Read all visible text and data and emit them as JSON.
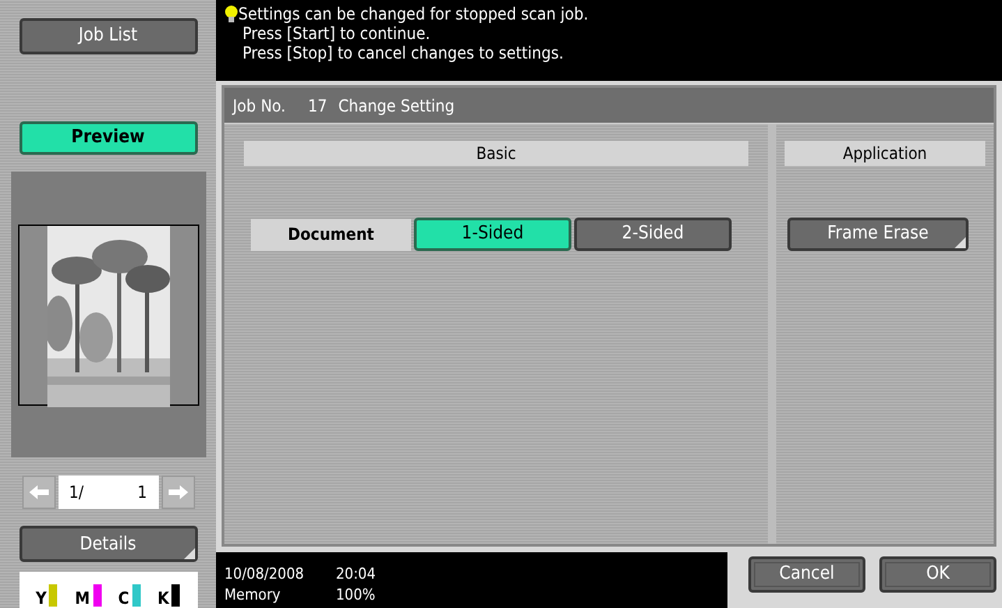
{
  "sidebar": {
    "job_list_button": "Job List",
    "preview_button": {
      "label": "Preview",
      "selected": true
    },
    "pager": {
      "page": "1/",
      "total": "1"
    },
    "details_button": "Details",
    "toners": [
      {
        "label": "Y",
        "color": "#c8c800"
      },
      {
        "label": "M",
        "color": "#f000f0"
      },
      {
        "label": "C",
        "color": "#30c8c8"
      },
      {
        "label": "K",
        "color": "#000000"
      }
    ]
  },
  "message": {
    "lines": [
      "Settings can be changed for stopped scan job.",
      "Press [Start] to continue.",
      "Press [Stop] to cancel changes to settings."
    ]
  },
  "panel": {
    "job_label": "Job No.",
    "job_number": "17",
    "title": "Change Setting",
    "basic": {
      "header": "Basic",
      "row_label": "Document",
      "options": [
        {
          "label": "1-Sided",
          "selected": true
        },
        {
          "label": "2-Sided",
          "selected": false
        }
      ]
    },
    "application": {
      "header": "Application",
      "buttons": [
        "Frame Erase"
      ]
    }
  },
  "status_bar": {
    "date": "10/08/2008",
    "time": "20:04",
    "memory_label": "Memory",
    "memory_value": "100%"
  },
  "buttons": [
    "Cancel",
    "OK"
  ]
}
